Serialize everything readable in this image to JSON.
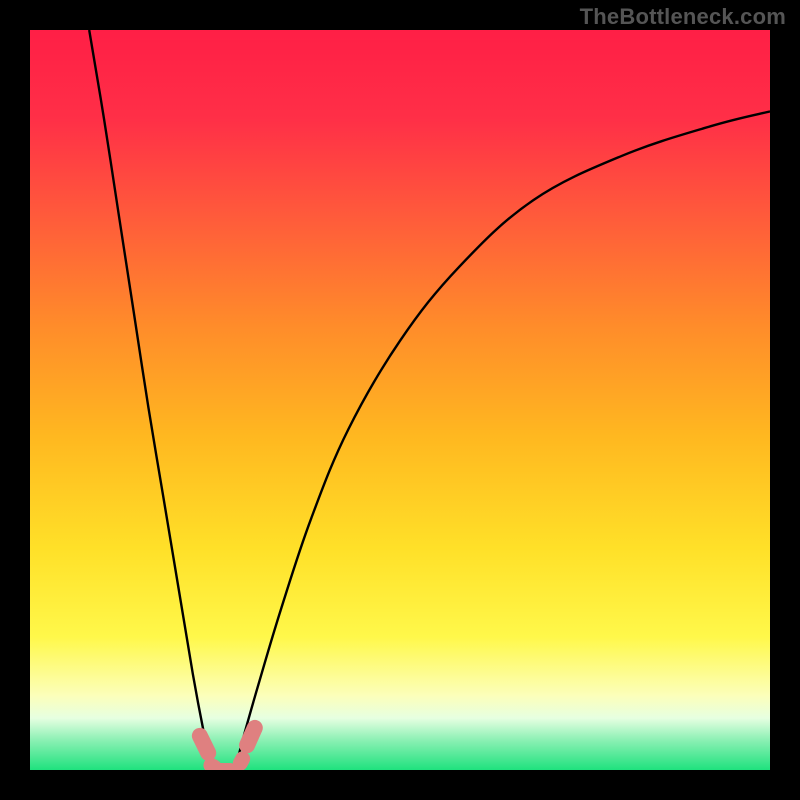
{
  "watermark": "TheBottleneck.com",
  "colors": {
    "black": "#000000",
    "marker": "#df8080",
    "curve": "#000000",
    "gradient_stops": [
      {
        "offset": 0.0,
        "color": "#ff1f46"
      },
      {
        "offset": 0.12,
        "color": "#ff2f47"
      },
      {
        "offset": 0.25,
        "color": "#ff5a3b"
      },
      {
        "offset": 0.4,
        "color": "#ff8c2a"
      },
      {
        "offset": 0.55,
        "color": "#ffb820"
      },
      {
        "offset": 0.7,
        "color": "#ffe028"
      },
      {
        "offset": 0.82,
        "color": "#fff84a"
      },
      {
        "offset": 0.9,
        "color": "#fcffbb"
      },
      {
        "offset": 0.93,
        "color": "#e6ffe1"
      },
      {
        "offset": 0.96,
        "color": "#8af0b3"
      },
      {
        "offset": 1.0,
        "color": "#1fe27e"
      }
    ]
  },
  "chart_data": {
    "type": "line",
    "title": "",
    "xlabel": "",
    "ylabel": "",
    "x_range": [
      0,
      100
    ],
    "y_range": [
      0,
      100
    ],
    "series": [
      {
        "name": "left-branch",
        "x": [
          8,
          10,
          12,
          14,
          16,
          18,
          20,
          22,
          23.5,
          24.6
        ],
        "y": [
          100,
          88,
          75,
          62,
          49,
          37,
          25,
          13,
          5,
          0
        ]
      },
      {
        "name": "right-branch",
        "x": [
          27.7,
          29,
          31,
          34,
          38,
          43,
          50,
          58,
          68,
          80,
          92,
          100
        ],
        "y": [
          0,
          5,
          12,
          22,
          34,
          46,
          58,
          68,
          77,
          83,
          87,
          89
        ]
      },
      {
        "name": "valley-floor",
        "x": [
          24.6,
          27.7
        ],
        "y": [
          0,
          0
        ]
      }
    ],
    "markers": [
      {
        "name": "left-end-marker",
        "x": 23.5,
        "y": 3.5,
        "w": 2.1,
        "h": 4.7,
        "rot": -26
      },
      {
        "name": "left-bottom-marker",
        "x": 24.6,
        "y": 0.5,
        "w": 2.0,
        "h": 2.5,
        "rot": -60
      },
      {
        "name": "floor-marker",
        "x": 26.2,
        "y": 0.0,
        "w": 3.6,
        "h": 1.8,
        "rot": 0
      },
      {
        "name": "right-bottom-marker",
        "x": 28.6,
        "y": 1.2,
        "w": 2.0,
        "h": 2.7,
        "rot": 28
      },
      {
        "name": "right-end-marker",
        "x": 29.8,
        "y": 4.5,
        "w": 2.1,
        "h": 4.7,
        "rot": 24
      }
    ]
  }
}
